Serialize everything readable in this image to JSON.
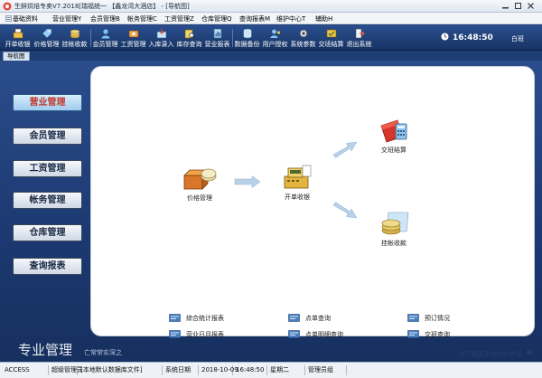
{
  "window": {
    "title": "生鲜烘焙专卖V7.2018[瑞福统一 【鑫龙湾大酒店】 - [导航图]",
    "buttons": [
      "minimize",
      "maximize",
      "close"
    ]
  },
  "menu": [
    {
      "label": "基础资料",
      "icon": "list-icon"
    },
    {
      "label": "营业管理Y"
    },
    {
      "label": "会员管理B"
    },
    {
      "label": "帐务管理C"
    },
    {
      "label": "工资管理Z"
    },
    {
      "label": "仓库管理Q"
    },
    {
      "label": "查询报表M"
    },
    {
      "label": "维护中心T"
    },
    {
      "label": "辅助H"
    }
  ],
  "toolbar": {
    "buttons": [
      {
        "label": "开单收银",
        "icon": "cashier-icon",
        "color": "#f1c34a"
      },
      {
        "label": "价格管理",
        "icon": "tag-icon",
        "color": "#9ad0f5"
      },
      {
        "label": "挂帐收款",
        "icon": "coins-icon",
        "color": "#e6c261"
      },
      {
        "label": "会员管理",
        "icon": "member-icon",
        "color": "#7fc3f0"
      },
      {
        "label": "工资管理",
        "icon": "salary-icon",
        "color": "#f0a44a"
      },
      {
        "label": "入库录入",
        "icon": "stock-in-icon",
        "color": "#c9e3f7"
      },
      {
        "label": "库存查询",
        "icon": "inventory-search-icon",
        "color": "#f2d36b"
      },
      {
        "label": "营业报表",
        "icon": "report-icon",
        "color": "#b5d8f3"
      },
      {
        "label": "数据备份",
        "icon": "backup-icon",
        "color": "#cfe6f6"
      },
      {
        "label": "用户授权",
        "icon": "user-auth-icon",
        "color": "#8ac6ef"
      },
      {
        "label": "系统参数",
        "icon": "settings-icon",
        "color": "#e1e8f0"
      },
      {
        "label": "交班结算",
        "icon": "handover-icon",
        "color": "#f1c34a"
      },
      {
        "label": "退出系统",
        "icon": "exit-icon",
        "color": "#e05a4a"
      }
    ],
    "clock": "16:48:50",
    "shift": "白班"
  },
  "tab": {
    "label": "导航图"
  },
  "nav": [
    {
      "label": "营业管理",
      "active": true
    },
    {
      "label": "会员管理"
    },
    {
      "label": "工资管理"
    },
    {
      "label": "帐务管理"
    },
    {
      "label": "仓库管理"
    },
    {
      "label": "查询报表"
    }
  ],
  "flow": {
    "price": {
      "label": "价格管理",
      "icon": "coins-box-icon"
    },
    "cashier": {
      "label": "开单收银",
      "icon": "cash-register-icon"
    },
    "handover": {
      "label": "交班结算",
      "icon": "calculator-icon"
    },
    "credit": {
      "label": "挂帐收款",
      "icon": "coin-stack-icon"
    }
  },
  "reports": [
    {
      "label": "综合统计报表"
    },
    {
      "label": "点单查询"
    },
    {
      "label": "预订情况"
    },
    {
      "label": "营业日月报表"
    },
    {
      "label": "点单明细查询"
    },
    {
      "label": "交班查询"
    }
  ],
  "footer": {
    "brand": "专业管理",
    "slogan": "亡常常实深之",
    "more_link": "想了解更多软件的信息"
  },
  "statusbar": {
    "cells": [
      "ACCESS",
      "超级管理员",
      "[本地默认数据库文件]",
      "系统日期",
      "2018-10-09",
      "16:48:50",
      "星期二",
      "管理员组"
    ]
  },
  "colors": {
    "navy": "#1f3e76",
    "panel": "#ffffff",
    "active_text": "#c0392b",
    "arrow": "#b9d1e8"
  }
}
